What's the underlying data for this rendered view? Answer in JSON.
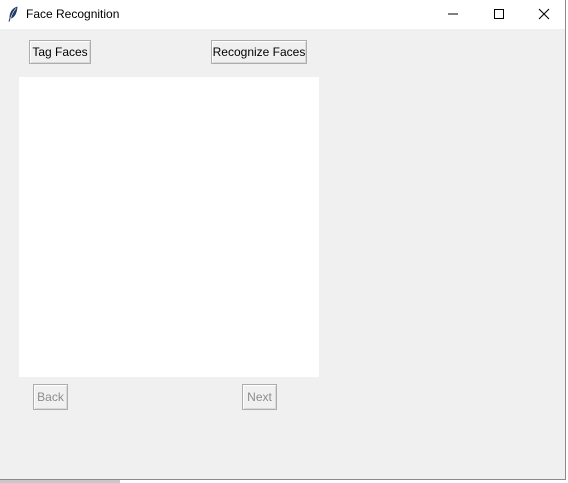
{
  "window": {
    "title": "Face Recognition",
    "icon": "feather-icon"
  },
  "titlebar_controls": {
    "minimize_icon": "minimize-icon",
    "maximize_icon": "maximize-icon",
    "close_icon": "close-icon"
  },
  "toolbar": {
    "tag_faces_label": "Tag Faces",
    "recognize_faces_label": "Recognize Faces"
  },
  "navigation": {
    "back_label": "Back",
    "back_enabled": false,
    "next_label": "Next",
    "next_enabled": false
  },
  "colors": {
    "window_background": "#f0f0f0",
    "canvas_background": "#ffffff",
    "disabled_text": "#8c8c8c"
  }
}
